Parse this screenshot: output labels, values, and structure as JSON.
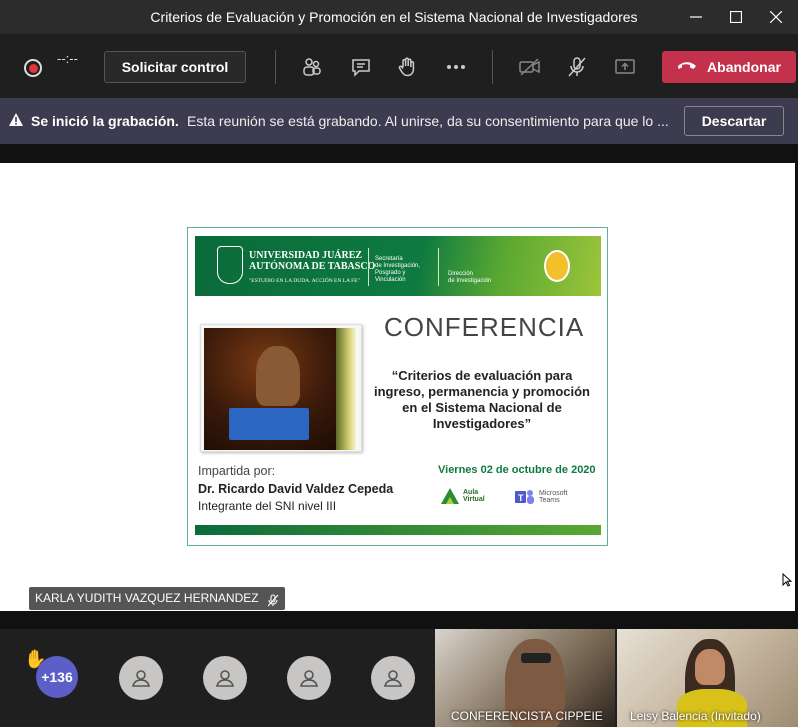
{
  "window": {
    "title": "Criterios de Evaluación y Promoción en el Sistema Nacional de Investigadores"
  },
  "toolbar": {
    "timer": "--:--",
    "request_control_label": "Solicitar control",
    "leave_label": "Abandonar"
  },
  "banner": {
    "title": "Se inició la grabación.",
    "text": "Esta reunión se está grabando. Al unirse, da su consentimiento para que lo ...",
    "dismiss_label": "Descartar"
  },
  "slide": {
    "university": "UNIVERSIDAD JUÁREZ\nAUTÓNOMA DE TABASCO",
    "motto": "\"ESTUDIO EN LA DUDA. ACCIÓN EN LA FE\"",
    "secretaria": "Secretaría\nde Investigación,\nPosgrado y\nVinculación",
    "direccion": "Dirección\nde Investigación",
    "heading": "CONFERENCIA",
    "subtitle": "“Criterios de evaluación para ingreso, permanencia y promoción en el Sistema Nacional de Investigadores”",
    "imparted_by": "Impartida por:",
    "speaker": "Dr. Ricardo David Valdez Cepeda",
    "speaker_role": "Integrante del SNI nivel III",
    "date": "Viernes 02 de octubre de 2020",
    "aula_label": "Aula\nVirtual",
    "teams_label": "Microsoft\nTeams"
  },
  "presenter_tag": "KARLA YUDITH VAZQUEZ HERNANDEZ",
  "gallery": {
    "participant_count": "+136",
    "videos": [
      {
        "name": "CONFERENCISTA CIPPEIE"
      },
      {
        "name": "Leisy Balencia (Invitado)"
      }
    ]
  },
  "colors": {
    "leave": "#c4314b",
    "banner": "#3d3b4f",
    "badge": "#5b5fc7",
    "uni_green": "#0e7a40"
  }
}
